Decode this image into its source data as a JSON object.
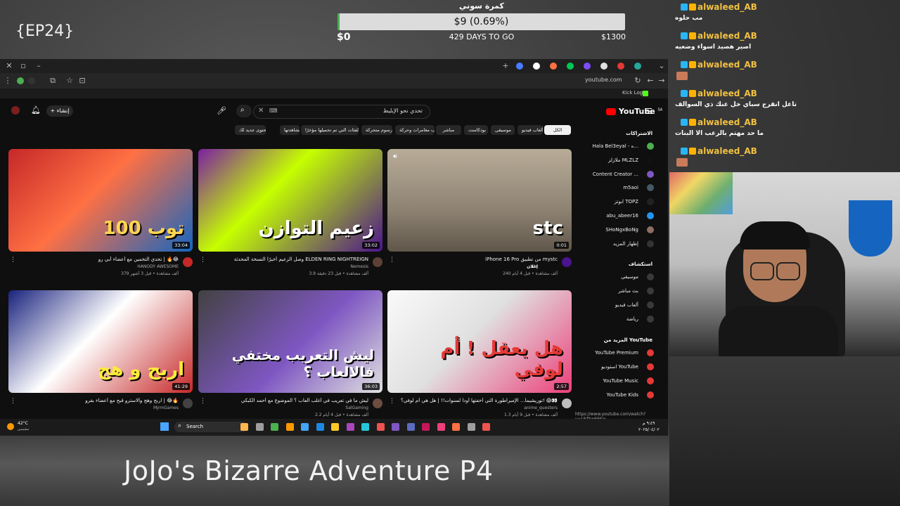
{
  "overlay": {
    "episode": "{EP24}",
    "bottom_title": "JoJo's Bizarre Adventure P4",
    "goal": {
      "title": "كمرة سوني",
      "amount": "$9 (0.69%)",
      "progress_fraction": 0.0069,
      "min": "$0",
      "days": "429 DAYS TO GO",
      "max": "$1300"
    }
  },
  "browser": {
    "url": "youtube.com",
    "kick_logo": "Kick Logo",
    "tab_colors": [
      "#4a7cff",
      "#ffffff",
      "#ff7043",
      "#00c853",
      "#7c4dff",
      "#e0e0e0",
      "#e53935",
      "#26a69a"
    ]
  },
  "youtube": {
    "logo": "YouTube",
    "logo_region": "SA",
    "search_value": "تحدي نحو الإبليط",
    "create_label": "إنشاء",
    "chips": [
      "الكل",
      "ألعاب فيديو",
      "موسيقى",
      "بودكاست",
      "مباشر",
      "ألعاب مغامرات وحركة",
      "رسوم متحركة",
      "الفئات التي تم تحميلها مؤخرًا",
      "تمت مشاهدتها",
      "محتوى جديد لك"
    ],
    "videos": [
      {
        "title": "تحدي التخمين مع أعضاء أبي رو | 🔥😂",
        "channel": "HANODY AWESOME",
        "meta": "379 ألف مشاهدة • قبل 3 أشهر",
        "duration": "33:04",
        "thumb_text": "توب 100",
        "avatar_color": "#c62828"
      },
      {
        "title": "وصل الزعيم أخيرًا النسخة المحدثة ELDEN RING NIGHTREIGN",
        "channel": "Nemesis",
        "meta": "3.9 ألف مشاهدة • قبل 23 دقيقة",
        "duration": "33:02",
        "thumb_text": "زعيم التوازن",
        "avatar_color": "#5d4037"
      },
      {
        "title": "iPhone 16 Pro من تطبيق mystc",
        "channel": "stc",
        "meta": "240 ألف مشاهدة • قبل 4 أيام",
        "duration": "0:01",
        "thumb_text": "stc",
        "ad_label": "إعلان",
        "avatar_color": "#4a148c"
      },
      {
        "title": "اربح وهج والاسترو قبح مع أعضاء بقرو | 😂🔥",
        "channel": "MjrmGames",
        "meta": "",
        "duration": "41:29",
        "thumb_text": "اربح و هج",
        "avatar_color": "#424242"
      },
      {
        "title": "ليش ما في تعريب في أغلب ألعاب ؟ الموضوع مع أحمد الكبكي",
        "channel": "SalGaming",
        "meta": "2.2 ألف مشاهدة • قبل 4 أيام",
        "duration": "36:03",
        "thumb_text": "ليش التعريب مختفي فالالعاب ؟",
        "avatar_color": "#6d4c41"
      },
      {
        "title": "توريشيما... الإمبراطورة التي أخفتها أودا لسنوات!! | هل هي أم لوفي؟! 😱👀",
        "channel": "anime_questers",
        "meta": "1.3 ألف مشاهدة • قبل 9 أيام",
        "duration": "2:57",
        "thumb_text": "هل يعقل ! أم لوفي",
        "avatar_color": "#bdbdbd"
      }
    ],
    "sidebar": {
      "subscriptions_heading": "الاشتراكات",
      "subscriptions": [
        "Hala Bel3eyal - ه...",
        "ملازلز MLZLZ",
        "Content Creator ...",
        "m5aoi",
        "ابوتز TOPZ",
        "abu_abeer16",
        "SHoNgxBoNg",
        "إظهار المزيد"
      ],
      "explore_heading": "استكشاف",
      "explore": [
        "موسيقى",
        "بث مباشر",
        "ألعاب فيديو",
        "رياضة"
      ],
      "more_heading": "المزيد من YouTube",
      "more": [
        "YouTube Premium",
        "استوديو YouTube",
        "YouTube Music",
        "YouTube Kids"
      ]
    },
    "status_url": "https://www.youtube.com/watch?v=UkfYw66Kw"
  },
  "taskbar": {
    "weather_temp": "42°C",
    "weather_label": "مشمس",
    "search_label": "Search",
    "clock_time": "٩:٤٩ م",
    "clock_date": "٢٠٢٥/٠٤/٠٢"
  },
  "chat": {
    "messages": [
      {
        "user": "alwaleed_AB",
        "text": "مب حلوه"
      },
      {
        "user": "alwaleed_AB",
        "text": "اصير هصيد اسواء وضعيه"
      },
      {
        "user": "alwaleed_AB",
        "text": ""
      },
      {
        "user": "alwaleed_AB",
        "text": "تاعل انقرج سباي خل عنك ذي السوالف"
      },
      {
        "user": "alwaleed_AB",
        "text": "ما حد مهتم بالرعب الا البنات"
      },
      {
        "user": "alwaleed_AB",
        "text": ""
      }
    ]
  }
}
